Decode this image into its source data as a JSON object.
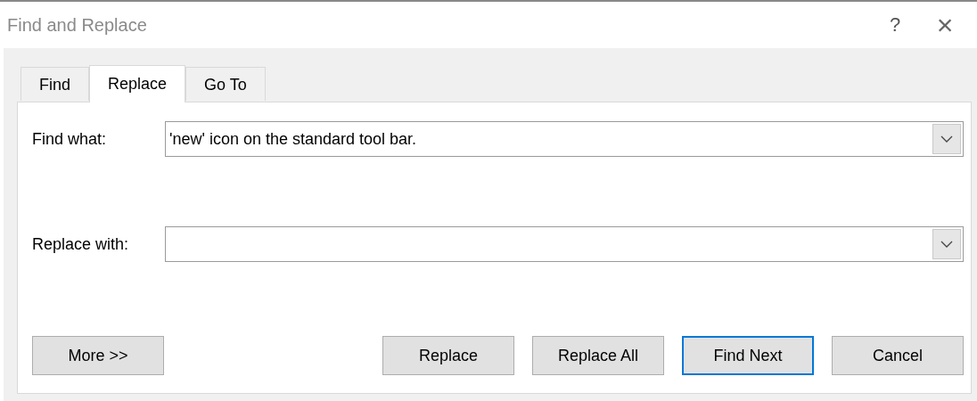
{
  "window": {
    "title": "Find and Replace",
    "help": "?",
    "close": "×"
  },
  "tabs": [
    {
      "label": "Find",
      "selected": false
    },
    {
      "label": "Replace",
      "selected": true
    },
    {
      "label": "Go To",
      "selected": false
    }
  ],
  "fields": [
    {
      "label": "Find what:",
      "value": "'new' icon on the standard tool bar."
    },
    {
      "label": "Replace with:"
    }
  ],
  "buttons": [
    {
      "label": "More >>",
      "default": false,
      "kind": "left"
    },
    {
      "label": "Replace",
      "default": false,
      "kind": "right"
    },
    {
      "label": "Replace All",
      "default": false,
      "kind": "right"
    },
    {
      "label": "Find Next",
      "default": true,
      "kind": "right"
    },
    {
      "label": "Cancel",
      "default": false,
      "kind": "right"
    }
  ]
}
